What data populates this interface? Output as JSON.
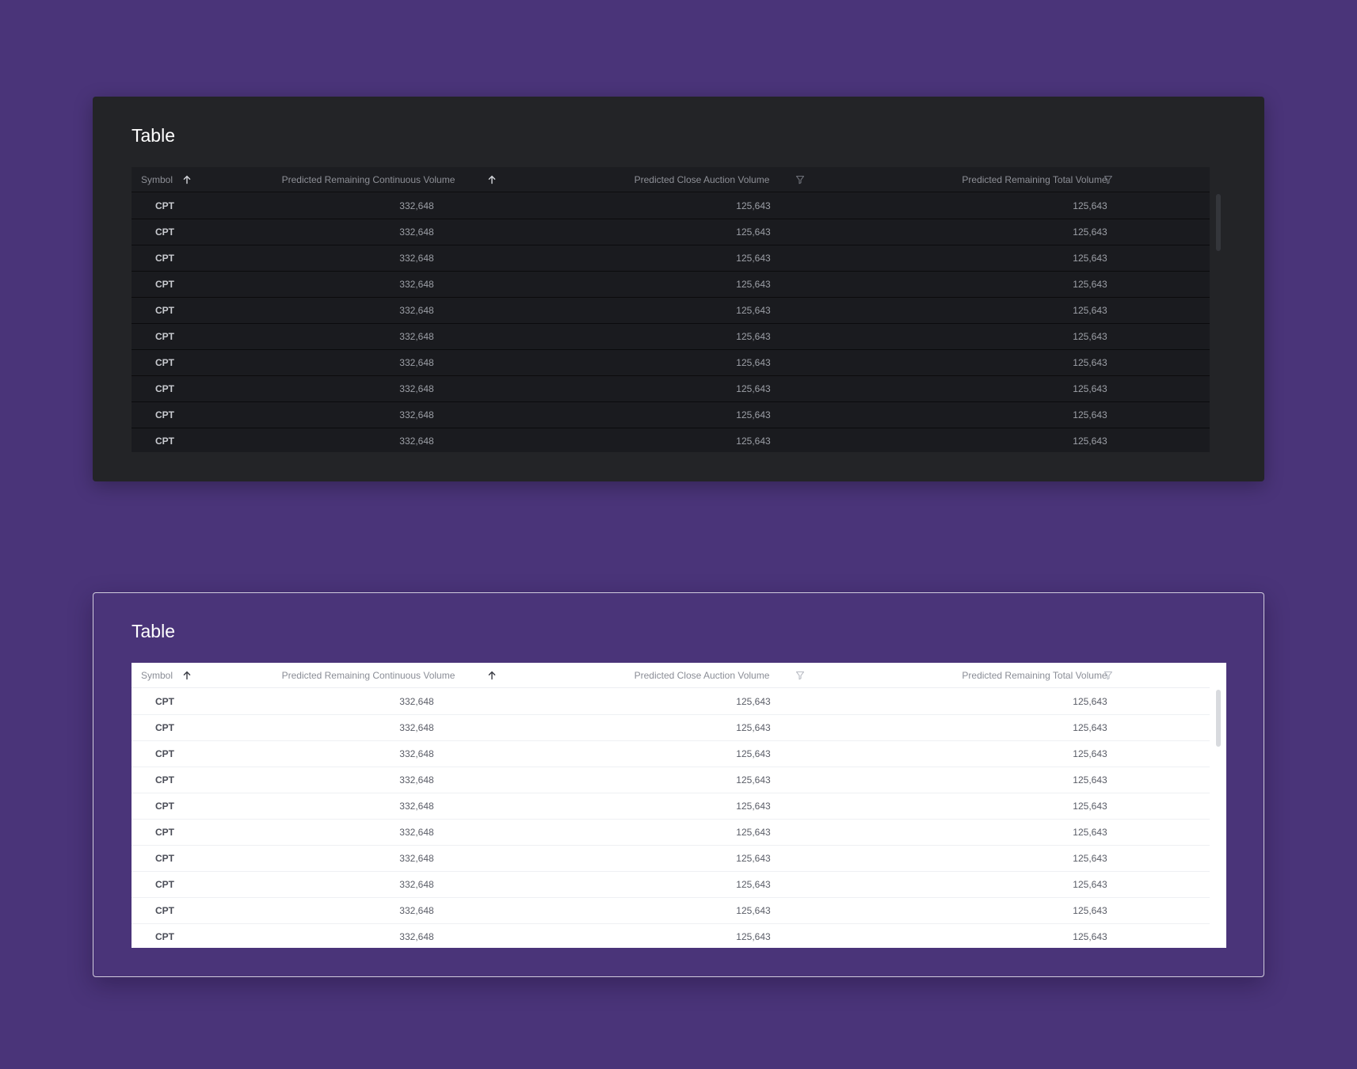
{
  "colors": {
    "page_background": "#4a3479",
    "dark_card": "#232427",
    "dark_table": "#1c1d21",
    "light_table": "#ffffff"
  },
  "cards": [
    {
      "theme": "dark",
      "title": "Table",
      "columns": [
        {
          "label": "Symbol",
          "icon": "sort-ascending-icon"
        },
        {
          "label": "Predicted Remaining Continuous Volume",
          "icon": "sort-ascending-icon"
        },
        {
          "label": "Predicted Close Auction Volume",
          "icon": "filter-icon"
        },
        {
          "label": "Predicted Remaining Total Volume",
          "icon": "filter-icon"
        }
      ],
      "rows": [
        [
          "CPT",
          "332,648",
          "125,643",
          "125,643"
        ],
        [
          "CPT",
          "332,648",
          "125,643",
          "125,643"
        ],
        [
          "CPT",
          "332,648",
          "125,643",
          "125,643"
        ],
        [
          "CPT",
          "332,648",
          "125,643",
          "125,643"
        ],
        [
          "CPT",
          "332,648",
          "125,643",
          "125,643"
        ],
        [
          "CPT",
          "332,648",
          "125,643",
          "125,643"
        ],
        [
          "CPT",
          "332,648",
          "125,643",
          "125,643"
        ],
        [
          "CPT",
          "332,648",
          "125,643",
          "125,643"
        ],
        [
          "CPT",
          "332,648",
          "125,643",
          "125,643"
        ],
        [
          "CPT",
          "332,648",
          "125,643",
          "125,643"
        ]
      ]
    },
    {
      "theme": "light",
      "title": "Table",
      "columns": [
        {
          "label": "Symbol",
          "icon": "sort-ascending-icon"
        },
        {
          "label": "Predicted Remaining Continuous Volume",
          "icon": "sort-ascending-icon"
        },
        {
          "label": "Predicted Close Auction Volume",
          "icon": "filter-icon"
        },
        {
          "label": "Predicted Remaining Total Volume",
          "icon": "filter-icon"
        }
      ],
      "rows": [
        [
          "CPT",
          "332,648",
          "125,643",
          "125,643"
        ],
        [
          "CPT",
          "332,648",
          "125,643",
          "125,643"
        ],
        [
          "CPT",
          "332,648",
          "125,643",
          "125,643"
        ],
        [
          "CPT",
          "332,648",
          "125,643",
          "125,643"
        ],
        [
          "CPT",
          "332,648",
          "125,643",
          "125,643"
        ],
        [
          "CPT",
          "332,648",
          "125,643",
          "125,643"
        ],
        [
          "CPT",
          "332,648",
          "125,643",
          "125,643"
        ],
        [
          "CPT",
          "332,648",
          "125,643",
          "125,643"
        ],
        [
          "CPT",
          "332,648",
          "125,643",
          "125,643"
        ],
        [
          "CPT",
          "332,648",
          "125,643",
          "125,643"
        ]
      ]
    }
  ]
}
